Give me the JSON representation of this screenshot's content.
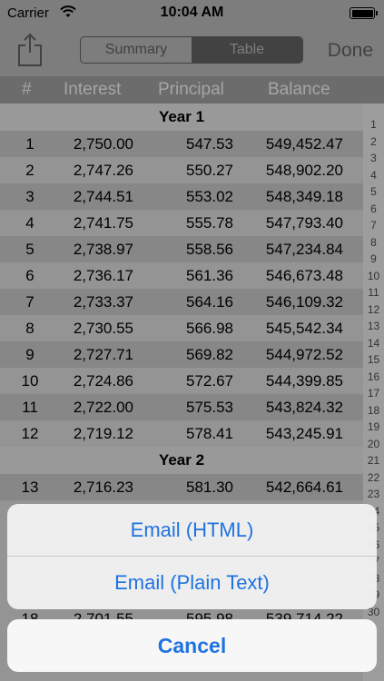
{
  "status_bar": {
    "carrier": "Carrier",
    "time": "10:04 AM"
  },
  "nav": {
    "segments": [
      {
        "label": "Summary",
        "selected": false
      },
      {
        "label": "Table",
        "selected": true
      }
    ],
    "done_label": "Done"
  },
  "columns": {
    "num": "#",
    "interest": "Interest",
    "principal": "Principal",
    "balance": "Balance"
  },
  "year1": {
    "label": "Year 1",
    "rows": [
      {
        "n": "1",
        "interest": "2,750.00",
        "principal": "547.53",
        "balance": "549,452.47"
      },
      {
        "n": "2",
        "interest": "2,747.26",
        "principal": "550.27",
        "balance": "548,902.20"
      },
      {
        "n": "3",
        "interest": "2,744.51",
        "principal": "553.02",
        "balance": "548,349.18"
      },
      {
        "n": "4",
        "interest": "2,741.75",
        "principal": "555.78",
        "balance": "547,793.40"
      },
      {
        "n": "5",
        "interest": "2,738.97",
        "principal": "558.56",
        "balance": "547,234.84"
      },
      {
        "n": "6",
        "interest": "2,736.17",
        "principal": "561.36",
        "balance": "546,673.48"
      },
      {
        "n": "7",
        "interest": "2,733.37",
        "principal": "564.16",
        "balance": "546,109.32"
      },
      {
        "n": "8",
        "interest": "2,730.55",
        "principal": "566.98",
        "balance": "545,542.34"
      },
      {
        "n": "9",
        "interest": "2,727.71",
        "principal": "569.82",
        "balance": "544,972.52"
      },
      {
        "n": "10",
        "interest": "2,724.86",
        "principal": "572.67",
        "balance": "544,399.85"
      },
      {
        "n": "11",
        "interest": "2,722.00",
        "principal": "575.53",
        "balance": "543,824.32"
      },
      {
        "n": "12",
        "interest": "2,719.12",
        "principal": "578.41",
        "balance": "543,245.91"
      }
    ]
  },
  "year2": {
    "label": "Year 2",
    "rows": [
      {
        "n": "13",
        "interest": "2,716.23",
        "principal": "581.30",
        "balance": "542,664.61"
      },
      {
        "n": "18",
        "interest": "2,701.55",
        "principal": "595.98",
        "balance": "539,714.22"
      }
    ]
  },
  "index_strip": [
    "1",
    "2",
    "3",
    "4",
    "5",
    "6",
    "7",
    "8",
    "9",
    "10",
    "11",
    "12",
    "13",
    "14",
    "15",
    "16",
    "17",
    "18",
    "19",
    "20",
    "21",
    "22",
    "23",
    "24",
    "25",
    "26",
    "27",
    "28",
    "29",
    "30"
  ],
  "action_sheet": {
    "email_html": "Email (HTML)",
    "email_plain": "Email (Plain Text)",
    "cancel": "Cancel"
  }
}
